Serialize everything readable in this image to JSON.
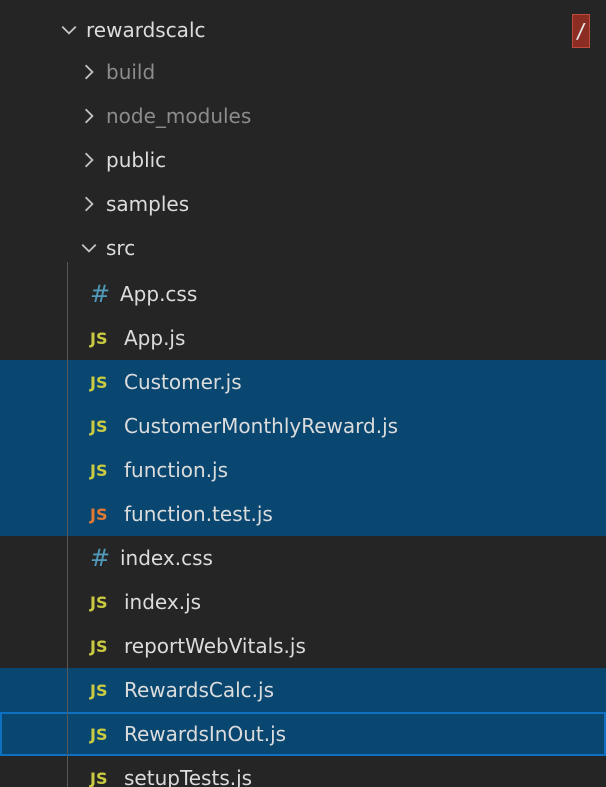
{
  "explorer": {
    "root": {
      "label": "rewardscalc",
      "expanded": true,
      "badge": "/"
    },
    "folders": [
      {
        "label": "build",
        "expanded": false,
        "dimmed": true
      },
      {
        "label": "node_modules",
        "expanded": false,
        "dimmed": true
      },
      {
        "label": "public",
        "expanded": false,
        "dimmed": false
      },
      {
        "label": "samples",
        "expanded": false,
        "dimmed": false
      },
      {
        "label": "src",
        "expanded": true,
        "dimmed": false
      }
    ],
    "files": [
      {
        "label": "App.css",
        "icon": "css-hash-icon",
        "icon_text": "#",
        "state": "none"
      },
      {
        "label": "App.js",
        "icon": "js-icon",
        "icon_text": "JS",
        "state": "none"
      },
      {
        "label": "Customer.js",
        "icon": "js-icon",
        "icon_text": "JS",
        "state": "selected"
      },
      {
        "label": "CustomerMonthlyReward.js",
        "icon": "js-icon",
        "icon_text": "JS",
        "state": "selected"
      },
      {
        "label": "function.js",
        "icon": "js-icon",
        "icon_text": "JS",
        "state": "selected"
      },
      {
        "label": "function.test.js",
        "icon": "js-test-icon",
        "icon_text": "JS",
        "state": "selected"
      },
      {
        "label": "index.css",
        "icon": "css-hash-icon",
        "icon_text": "#",
        "state": "none"
      },
      {
        "label": "index.js",
        "icon": "js-icon",
        "icon_text": "JS",
        "state": "none"
      },
      {
        "label": "reportWebVitals.js",
        "icon": "js-icon",
        "icon_text": "JS",
        "state": "none"
      },
      {
        "label": "RewardsCalc.js",
        "icon": "js-icon",
        "icon_text": "JS",
        "state": "selected"
      },
      {
        "label": "RewardsInOut.js",
        "icon": "js-icon",
        "icon_text": "JS",
        "state": "focused"
      },
      {
        "label": "setupTests.js",
        "icon": "js-icon",
        "icon_text": "JS",
        "state": "none"
      }
    ]
  },
  "colors": {
    "background": "#252526",
    "selection": "#094771",
    "focus_border": "#0e70c0",
    "js_icon": "#cbcb41",
    "js_test_icon": "#e37933",
    "css_icon": "#519aba",
    "badge": "#8b2d22"
  }
}
